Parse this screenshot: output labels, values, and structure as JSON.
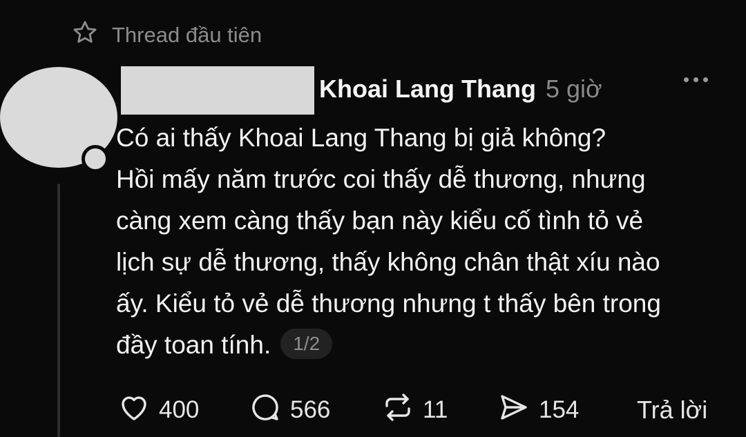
{
  "thread_tag": {
    "label": "Thread đầu tiên",
    "icon": "star-icon"
  },
  "author": {
    "username": "Khoai Lang Thang",
    "time": "5 giờ"
  },
  "post": {
    "lines": [
      "Có ai thấy Khoai Lang Thang bị giả không?",
      "Hồi mấy năm trước coi thấy dễ thương, nhưng",
      "càng xem càng thấy bạn này kiểu cố tình tỏ vẻ",
      "lịch sự dễ thương, thấy không chân thật xíu nào",
      "ấy. Kiểu tỏ vẻ dễ thương nhưng t thấy bên trong",
      "đầy toan tính."
    ],
    "page_indicator": "1/2"
  },
  "actions": {
    "likes": "400",
    "comments": "566",
    "reposts": "11",
    "shares": "154",
    "reply_label": "Trả lời"
  },
  "colors": {
    "background": "#0a0a0a",
    "text": "#f3f3f3",
    "muted": "#8a8a8a"
  }
}
